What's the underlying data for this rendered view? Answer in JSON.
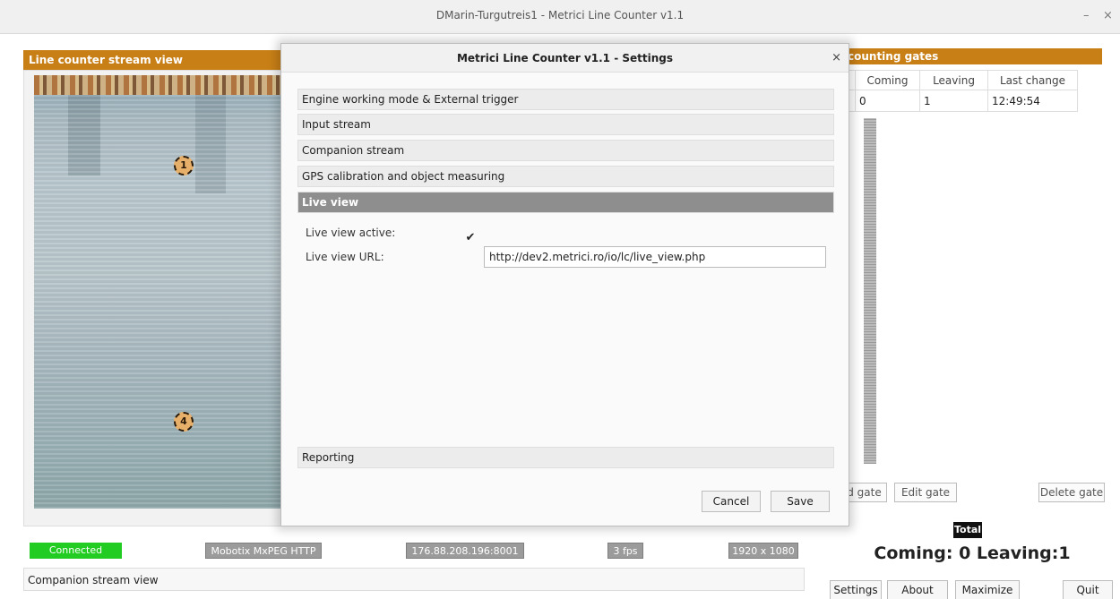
{
  "window": {
    "title": "DMarin-Turgutreis1 - Metrici Line Counter v1.1",
    "minimize_glyph": "–",
    "close_glyph": "×"
  },
  "stream_panel": {
    "header": "Line counter stream view",
    "gate_markers": [
      "1",
      "4"
    ]
  },
  "status": {
    "connection": "Connected",
    "camera": "Mobotix MxPEG HTTP",
    "address": "176.88.208.196:8001",
    "fps": "3 fps",
    "resolution": "1920 x 1080"
  },
  "companion": {
    "label": "Companion stream view"
  },
  "gates": {
    "header": "counting gates",
    "columns": [
      "Coming",
      "Leaving",
      "Last change"
    ],
    "rows": [
      {
        "coming": "0",
        "leaving": "1",
        "last_change": "12:49:54"
      }
    ],
    "add_label": "d gate",
    "edit_label": "Edit gate",
    "delete_label": "Delete gate"
  },
  "total": {
    "badge": "Total",
    "summary": "Coming: 0  Leaving:1"
  },
  "bottom_buttons": {
    "settings": "Settings",
    "about": "About",
    "maximize": "Maximize",
    "quit": "Quit"
  },
  "dialog": {
    "title": "Metrici Line Counter v1.1 - Settings",
    "close_glyph": "×",
    "sections": [
      "Engine working mode & External trigger",
      "Input stream",
      "Companion stream",
      "GPS calibration and object measuring",
      "Live view"
    ],
    "active_section": "Live view",
    "live_view_active_label": "Live view active:",
    "live_view_active_checked": true,
    "live_view_url_label": "Live view URL:",
    "live_view_url": "http://dev2.metrici.ro/io/lc/live_view.php",
    "reporting_section": "Reporting",
    "cancel": "Cancel",
    "save": "Save"
  },
  "colors": {
    "accent_orange": "#c87f16",
    "connected_green": "#22cc22",
    "active_section_gray": "#8e8e8e"
  }
}
